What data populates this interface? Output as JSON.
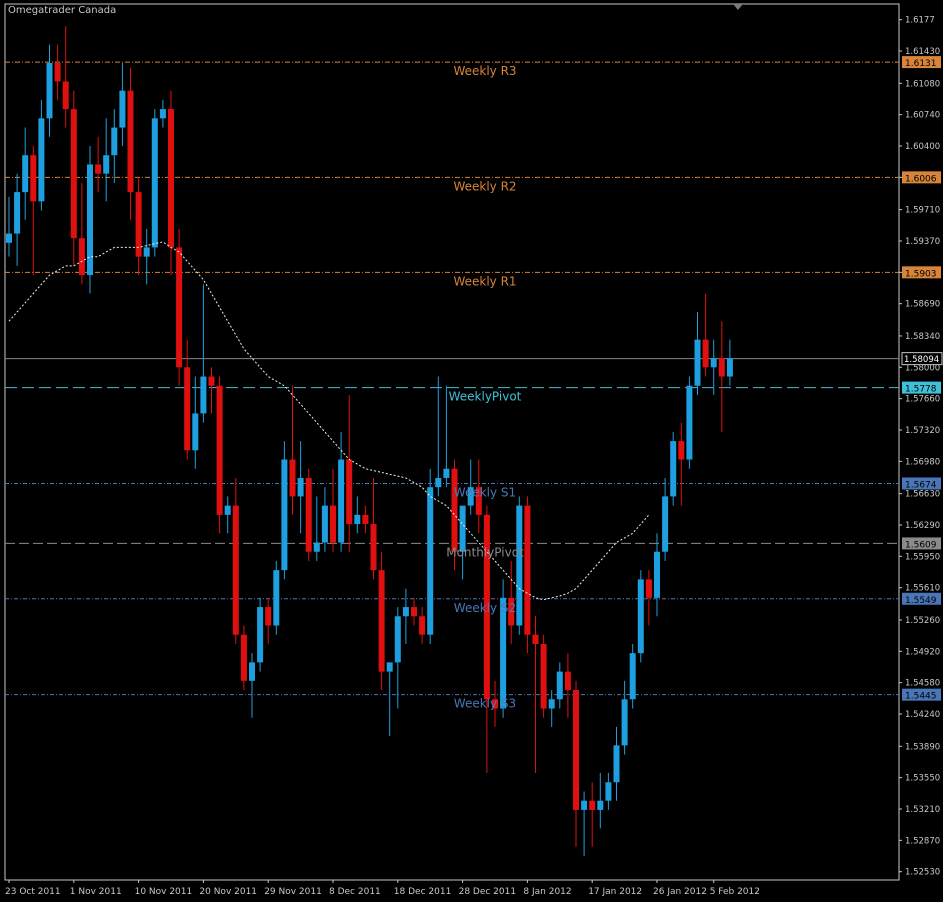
{
  "window": {
    "title": "Omegatrader Canada"
  },
  "colors": {
    "background": "#000000",
    "axis": "#c8c8c8",
    "bull": "#1e9fe0",
    "bear": "#e01010",
    "moving_average": "#f0f0f0",
    "resistance": "#d8843a",
    "pivot": "#40c0d8",
    "support": "#4a76b8",
    "monthly_pivot": "#8a8a8a",
    "current_price": "#7f8894"
  },
  "chart_data": {
    "type": "candlestick",
    "title": "",
    "xlabel": "",
    "ylabel": "",
    "ylim": [
      1.5244,
      1.6194
    ],
    "grid": false,
    "y_ticks": [
      1.6177,
      1.6143,
      1.6108,
      1.6074,
      1.604,
      1.6006,
      1.5971,
      1.5937,
      1.5903,
      1.5869,
      1.5834,
      1.58,
      1.5766,
      1.5732,
      1.5698,
      1.5663,
      1.5629,
      1.5595,
      1.5561,
      1.5526,
      1.5492,
      1.5458,
      1.5424,
      1.5389,
      1.5355,
      1.5321,
      1.5287,
      1.5253
    ],
    "x_ticks": [
      {
        "index": 0,
        "label": "23 Oct 2011"
      },
      {
        "index": 8,
        "label": "1 Nov 2011"
      },
      {
        "index": 16,
        "label": "10 Nov 2011"
      },
      {
        "index": 24,
        "label": "20 Nov 2011"
      },
      {
        "index": 32,
        "label": "29 Nov 2011"
      },
      {
        "index": 40,
        "label": "8 Dec 2011"
      },
      {
        "index": 48,
        "label": "18 Dec 2011"
      },
      {
        "index": 56,
        "label": "28 Dec 2011"
      },
      {
        "index": 64,
        "label": "8 Jan 2012"
      },
      {
        "index": 72,
        "label": "17 Jan 2012"
      },
      {
        "index": 80,
        "label": "26 Jan 2012"
      },
      {
        "index": 87,
        "label": "5 Feb 2012"
      }
    ],
    "candles": [
      [
        1.5935,
        1.5985,
        1.592,
        1.5945
      ],
      [
        1.5945,
        1.601,
        1.591,
        1.599
      ],
      [
        1.599,
        1.606,
        1.596,
        1.603
      ],
      [
        1.603,
        1.604,
        1.59,
        1.598
      ],
      [
        1.598,
        1.609,
        1.597,
        1.607
      ],
      [
        1.607,
        1.615,
        1.605,
        1.613
      ],
      [
        1.613,
        1.615,
        1.609,
        1.611
      ],
      [
        1.611,
        1.617,
        1.606,
        1.608
      ],
      [
        1.608,
        1.61,
        1.591,
        1.594
      ],
      [
        1.594,
        1.6,
        1.589,
        1.59
      ],
      [
        1.59,
        1.604,
        1.588,
        1.602
      ],
      [
        1.602,
        1.605,
        1.599,
        1.601
      ],
      [
        1.601,
        1.607,
        1.598,
        1.603
      ],
      [
        1.603,
        1.608,
        1.6,
        1.606
      ],
      [
        1.606,
        1.613,
        1.604,
        1.61
      ],
      [
        1.61,
        1.6125,
        1.596,
        1.599
      ],
      [
        1.599,
        1.6005,
        1.59,
        1.592
      ],
      [
        1.592,
        1.595,
        1.589,
        1.593
      ],
      [
        1.593,
        1.608,
        1.592,
        1.607
      ],
      [
        1.607,
        1.609,
        1.606,
        1.608
      ],
      [
        1.608,
        1.61,
        1.59,
        1.593
      ],
      [
        1.593,
        1.595,
        1.578,
        1.58
      ],
      [
        1.58,
        1.583,
        1.57,
        1.571
      ],
      [
        1.571,
        1.579,
        1.569,
        1.575
      ],
      [
        1.575,
        1.589,
        1.574,
        1.579
      ],
      [
        1.579,
        1.58,
        1.575,
        1.578
      ],
      [
        1.578,
        1.579,
        1.562,
        1.564
      ],
      [
        1.564,
        1.566,
        1.562,
        1.565
      ],
      [
        1.565,
        1.568,
        1.55,
        1.551
      ],
      [
        1.551,
        1.552,
        1.545,
        1.546
      ],
      [
        1.546,
        1.549,
        1.542,
        1.548
      ],
      [
        1.548,
        1.555,
        1.547,
        1.554
      ],
      [
        1.554,
        1.555,
        1.55,
        1.552
      ],
      [
        1.552,
        1.559,
        1.551,
        1.558
      ],
      [
        1.558,
        1.572,
        1.557,
        1.57
      ],
      [
        1.57,
        1.578,
        1.564,
        1.566
      ],
      [
        1.566,
        1.572,
        1.562,
        1.568
      ],
      [
        1.568,
        1.569,
        1.559,
        1.56
      ],
      [
        1.56,
        1.566,
        1.559,
        1.561
      ],
      [
        1.561,
        1.567,
        1.56,
        1.565
      ],
      [
        1.565,
        1.569,
        1.56,
        1.561
      ],
      [
        1.561,
        1.573,
        1.56,
        1.57
      ],
      [
        1.57,
        1.577,
        1.56,
        1.563
      ],
      [
        1.563,
        1.566,
        1.562,
        1.564
      ],
      [
        1.564,
        1.565,
        1.562,
        1.563
      ],
      [
        1.563,
        1.568,
        1.557,
        1.558
      ],
      [
        1.558,
        1.56,
        1.545,
        1.547
      ],
      [
        1.547,
        1.548,
        1.54,
        1.548
      ],
      [
        1.548,
        1.554,
        1.543,
        1.553
      ],
      [
        1.553,
        1.556,
        1.55,
        1.554
      ],
      [
        1.554,
        1.555,
        1.552,
        1.553
      ],
      [
        1.553,
        1.554,
        1.55,
        1.551
      ],
      [
        1.551,
        1.569,
        1.55,
        1.567
      ],
      [
        1.567,
        1.579,
        1.566,
        1.568
      ],
      [
        1.568,
        1.578,
        1.567,
        1.569
      ],
      [
        1.569,
        1.57,
        1.558,
        1.56
      ],
      [
        1.56,
        1.564,
        1.557,
        1.565
      ],
      [
        1.565,
        1.57,
        1.564,
        1.567
      ],
      [
        1.567,
        1.57,
        1.562,
        1.564
      ],
      [
        1.564,
        1.565,
        1.536,
        1.544
      ],
      [
        1.544,
        1.546,
        1.541,
        1.543
      ],
      [
        1.543,
        1.557,
        1.542,
        1.555
      ],
      [
        1.555,
        1.559,
        1.55,
        1.552
      ],
      [
        1.552,
        1.566,
        1.551,
        1.565
      ],
      [
        1.565,
        1.566,
        1.549,
        1.551
      ],
      [
        1.551,
        1.553,
        1.536,
        1.55
      ],
      [
        1.55,
        1.551,
        1.542,
        1.543
      ],
      [
        1.543,
        1.545,
        1.541,
        1.544
      ],
      [
        1.544,
        1.548,
        1.543,
        1.547
      ],
      [
        1.547,
        1.549,
        1.542,
        1.545
      ],
      [
        1.545,
        1.546,
        1.528,
        1.532
      ],
      [
        1.532,
        1.534,
        1.527,
        1.533
      ],
      [
        1.533,
        1.535,
        1.528,
        1.532
      ],
      [
        1.532,
        1.536,
        1.53,
        1.533
      ],
      [
        1.533,
        1.536,
        1.532,
        1.535
      ],
      [
        1.535,
        1.541,
        1.533,
        1.539
      ],
      [
        1.539,
        1.546,
        1.538,
        1.544
      ],
      [
        1.544,
        1.55,
        1.543,
        1.549
      ],
      [
        1.549,
        1.558,
        1.548,
        1.557
      ],
      [
        1.557,
        1.558,
        1.552,
        1.555
      ],
      [
        1.555,
        1.562,
        1.553,
        1.56
      ],
      [
        1.56,
        1.568,
        1.559,
        1.566
      ],
      [
        1.566,
        1.573,
        1.565,
        1.572
      ],
      [
        1.572,
        1.574,
        1.565,
        1.57
      ],
      [
        1.57,
        1.579,
        1.569,
        1.578
      ],
      [
        1.578,
        1.586,
        1.577,
        1.583
      ],
      [
        1.583,
        1.588,
        1.579,
        1.58
      ],
      [
        1.58,
        1.583,
        1.577,
        1.581
      ],
      [
        1.581,
        1.585,
        1.573,
        1.579
      ],
      [
        1.579,
        1.583,
        1.578,
        1.581
      ]
    ],
    "moving_average": {
      "start_index": 0,
      "values": [
        1.585,
        1.586,
        1.587,
        1.588,
        1.589,
        1.59,
        1.5905,
        1.591,
        1.591,
        1.5915,
        1.592,
        1.592,
        1.5925,
        1.593,
        1.593,
        1.593,
        1.593,
        1.5932,
        1.5934,
        1.5936,
        1.593,
        1.5925,
        1.5915,
        1.5905,
        1.5895,
        1.588,
        1.5865,
        1.585,
        1.5835,
        1.582,
        1.581,
        1.58,
        1.579,
        1.5785,
        1.578,
        1.577,
        1.576,
        1.575,
        1.574,
        1.573,
        1.572,
        1.571,
        1.57,
        1.5695,
        1.569,
        1.5688,
        1.5686,
        1.5684,
        1.5682,
        1.568,
        1.5675,
        1.567,
        1.566,
        1.5655,
        1.565,
        1.564,
        1.563,
        1.562,
        1.561,
        1.56,
        1.559,
        1.558,
        1.557,
        1.556,
        1.5555,
        1.555,
        1.5548,
        1.555,
        1.5552,
        1.5555,
        1.556,
        1.557,
        1.558,
        1.559,
        1.56,
        1.561,
        1.5615,
        1.562,
        1.563,
        1.564
      ]
    },
    "levels": [
      {
        "name": "Weekly R3",
        "value": 1.6131,
        "price_label": "1.6131",
        "style": "resistance"
      },
      {
        "name": "Weekly R2",
        "value": 1.6006,
        "price_label": "1.6006",
        "style": "resistance"
      },
      {
        "name": "Weekly R1",
        "value": 1.5903,
        "price_label": "1.5903",
        "style": "resistance"
      },
      {
        "name": "WeeklyPivot",
        "value": 1.5778,
        "price_label": "1.5778",
        "style": "pivot"
      },
      {
        "name": "Weekly S1",
        "value": 1.5674,
        "price_label": "1.5674",
        "style": "support"
      },
      {
        "name": "MonthlyPivot",
        "value": 1.5609,
        "price_label": "1.5609",
        "style": "monthly_pivot"
      },
      {
        "name": "Weekly S2",
        "value": 1.5549,
        "price_label": "1.5549",
        "style": "support"
      },
      {
        "name": "Weekly S3",
        "value": 1.5445,
        "price_label": "1.5445",
        "style": "support"
      }
    ],
    "current_price": {
      "value": 1.58094,
      "label": "1.58094"
    }
  }
}
